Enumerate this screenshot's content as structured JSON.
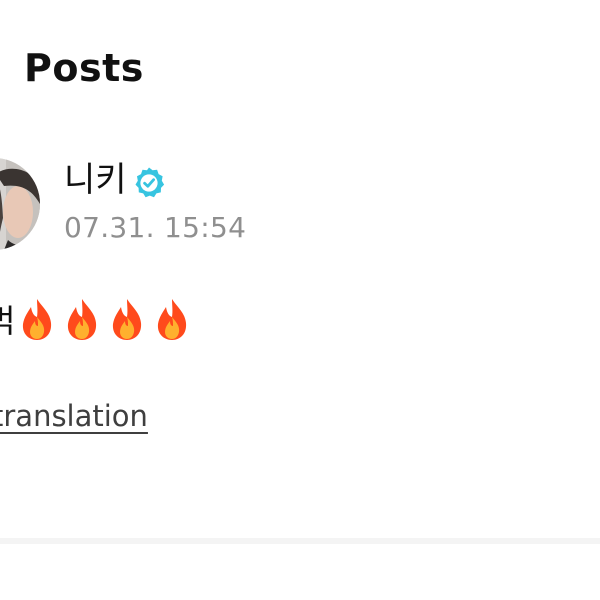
{
  "header": {
    "title": "Posts"
  },
  "post": {
    "author_name": "니키",
    "verified": true,
    "timestamp": "07.31. 15:54",
    "text_fragment": "벅",
    "fire_emoji_count": 4,
    "translation_link_label": "translation"
  },
  "colors": {
    "verified_badge": "#37c4e0",
    "timestamp": "#8f8f8f",
    "fire_outer": "#ff4a1c",
    "fire_inner": "#ffb02e"
  }
}
